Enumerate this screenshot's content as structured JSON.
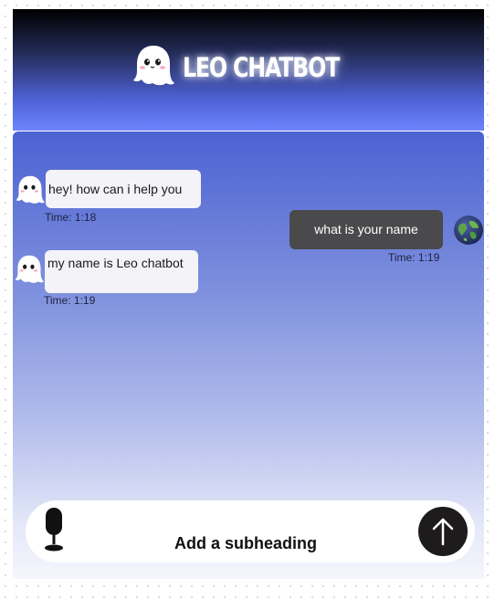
{
  "header": {
    "title": "LEO CHATBOT",
    "logo_icon": "ghost-icon"
  },
  "messages": [
    {
      "sender": "bot",
      "avatar_icon": "ghost-icon",
      "text": "hey! how can i help you",
      "time": "Time: 1:18"
    },
    {
      "sender": "user",
      "avatar_icon": "globe-icon",
      "text": "what is your name",
      "time": "Time: 1:19"
    },
    {
      "sender": "bot",
      "avatar_icon": "ghost-icon",
      "text": "my name is Leo chatbot",
      "time": "Time: 1:19"
    }
  ],
  "input_bar": {
    "mic_icon": "microphone-icon",
    "label": "Add a subheading",
    "send_icon": "arrow-up-icon"
  },
  "colors": {
    "header_top": "#000000",
    "header_bottom": "#6d84ff",
    "chat_top": "#4b62d2",
    "chat_bottom": "#f5f6fc",
    "user_bubble": "#4a4a4c",
    "bot_bubble": "#f3f3f8",
    "send_button": "#1e1b1c"
  }
}
